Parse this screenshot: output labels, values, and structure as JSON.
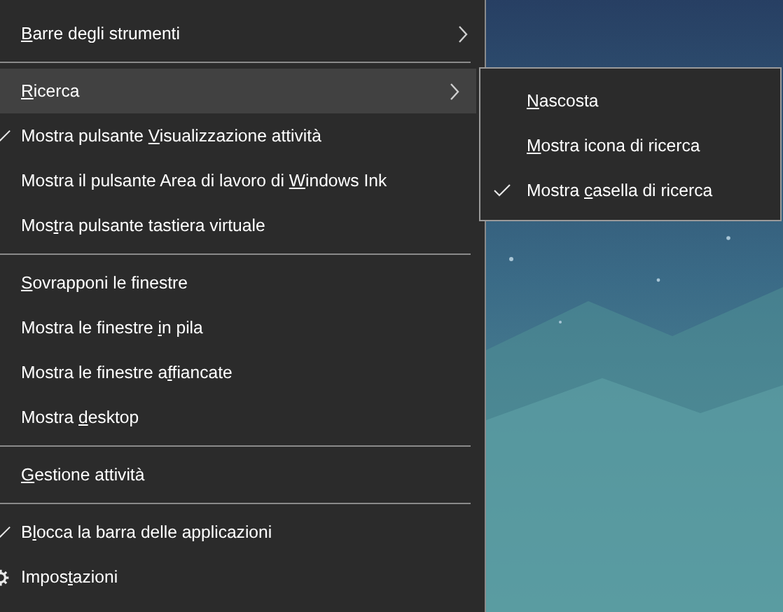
{
  "menu": {
    "items": [
      {
        "kind": "item",
        "label": {
          "key": "B",
          "after": "arre degli strumenti"
        },
        "has_submenu": true,
        "highlighted": false,
        "checked": false
      },
      {
        "kind": "separator"
      },
      {
        "kind": "item",
        "label": {
          "key": "R",
          "after": "icerca"
        },
        "has_submenu": true,
        "highlighted": true,
        "checked": false
      },
      {
        "kind": "item",
        "label": {
          "before": "Mostra pulsante ",
          "key": "V",
          "after": "isualizzazione attività"
        },
        "has_submenu": false,
        "highlighted": false,
        "checked": true
      },
      {
        "kind": "item",
        "label": {
          "before": "Mostra il pulsante Area di lavoro di ",
          "key": "W",
          "after": "indows Ink"
        },
        "has_submenu": false,
        "highlighted": false,
        "checked": false
      },
      {
        "kind": "item",
        "label": {
          "before": "Mos",
          "key": "t",
          "after": "ra pulsante tastiera virtuale"
        },
        "has_submenu": false,
        "highlighted": false,
        "checked": false
      },
      {
        "kind": "separator"
      },
      {
        "kind": "item",
        "label": {
          "key": "S",
          "after": "ovrapponi le finestre"
        },
        "has_submenu": false,
        "highlighted": false,
        "checked": false
      },
      {
        "kind": "item",
        "label": {
          "before": "Mostra le finestre ",
          "key": "i",
          "after": "n pila"
        },
        "has_submenu": false,
        "highlighted": false,
        "checked": false
      },
      {
        "kind": "item",
        "label": {
          "before": "Mostra le finestre a",
          "key": "f",
          "after": "fiancate"
        },
        "has_submenu": false,
        "highlighted": false,
        "checked": false
      },
      {
        "kind": "item",
        "label": {
          "before": "Mostra ",
          "key": "d",
          "after": "esktop"
        },
        "has_submenu": false,
        "highlighted": false,
        "checked": false
      },
      {
        "kind": "separator"
      },
      {
        "kind": "item",
        "label": {
          "key": "G",
          "after": "estione attività"
        },
        "has_submenu": false,
        "highlighted": false,
        "checked": false
      },
      {
        "kind": "separator"
      },
      {
        "kind": "item",
        "label": {
          "before": "B",
          "key": "l",
          "after": "occa la barra delle applicazioni"
        },
        "has_submenu": false,
        "highlighted": false,
        "checked": true
      },
      {
        "kind": "settings",
        "label": {
          "before": "Impos",
          "key": "t",
          "after": "azioni"
        },
        "has_submenu": false,
        "highlighted": false,
        "checked": false
      }
    ]
  },
  "submenu": {
    "items": [
      {
        "kind": "item",
        "label": {
          "key": "N",
          "after": "ascosta"
        },
        "checked": false
      },
      {
        "kind": "item",
        "label": {
          "key": "M",
          "after": "ostra icona di ricerca"
        },
        "checked": false
      },
      {
        "kind": "item",
        "label": {
          "before": "Mostra ",
          "key": "c",
          "after": "asella di ricerca"
        },
        "checked": true
      }
    ]
  }
}
